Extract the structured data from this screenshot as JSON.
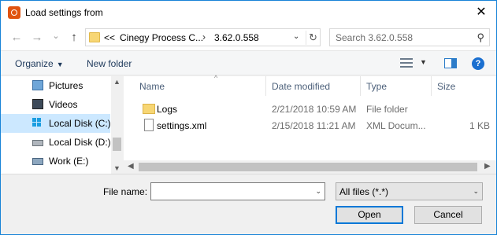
{
  "window": {
    "title": "Load settings from",
    "close_label": "✕"
  },
  "nav": {
    "back_glyph": "←",
    "forward_glyph": "→",
    "recent_glyph": "⌄",
    "up_glyph": "↑",
    "breadcrumb_overflow": "<<",
    "breadcrumb": [
      "Cinegy Process C...",
      "3.62.0.558"
    ],
    "breadcrumb_sep": "›",
    "dropdown_glyph": "⌄",
    "refresh_glyph": "↻",
    "search_placeholder": "Search 3.62.0.558",
    "search_glyph": "⚲"
  },
  "toolbar": {
    "organize_label": "Organize",
    "organize_caret": "▼",
    "new_folder_label": "New folder",
    "view_caret": "▼",
    "help_glyph": "?"
  },
  "sidebar": {
    "items": [
      {
        "label": "Pictures",
        "icon": "pictures-icon"
      },
      {
        "label": "Videos",
        "icon": "videos-icon"
      },
      {
        "label": "Local Disk (C:)",
        "icon": "windows-drive-icon",
        "selected": true
      },
      {
        "label": "Local Disk (D:)",
        "icon": "drive-icon"
      },
      {
        "label": "Work (E:)",
        "icon": "network-drive-icon"
      }
    ],
    "scroll_up": "▲",
    "scroll_down": "▼"
  },
  "filelist": {
    "columns": [
      "Name",
      "Date modified",
      "Type",
      "Size"
    ],
    "sort_caret": "^",
    "rows": [
      {
        "name": "Logs",
        "date": "2/21/2018 10:59 AM",
        "type": "File folder",
        "size": "",
        "icon": "folder-icon"
      },
      {
        "name": "settings.xml",
        "date": "2/15/2018 11:21 AM",
        "type": "XML Docum...",
        "size": "1 KB",
        "icon": "file-icon"
      }
    ],
    "scroll_left": "◀",
    "scroll_right": "▶"
  },
  "footer": {
    "filename_label": "File name:",
    "filename_value": "",
    "filename_caret": "⌄",
    "filter_value": "All files (*.*)",
    "filter_caret": "⌄",
    "open_label": "Open",
    "cancel_label": "Cancel"
  },
  "colors": {
    "accent": "#0078d7",
    "selection": "#cce8ff",
    "folder": "#f7d674"
  }
}
